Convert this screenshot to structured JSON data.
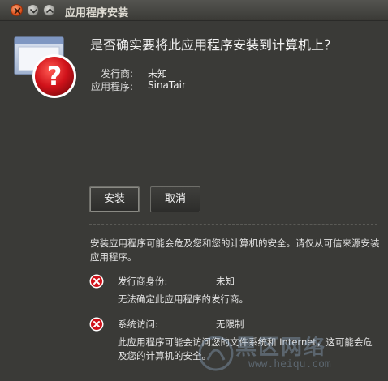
{
  "window": {
    "title": "应用程序安装"
  },
  "dialog": {
    "question": "是否确实要将此应用程序安装到计算机上？",
    "publisher_label": "发行商:",
    "publisher_value": "未知",
    "app_label": "应用程序:",
    "app_value": "SinaTair",
    "install_button": "安装",
    "cancel_button": "取消",
    "warning_text": "安装应用程序可能会危及您和您的计算机的安全。请仅从可信来源安装应用程序。",
    "items": [
      {
        "label": "发行商身份:",
        "value": "未知",
        "description": "无法确定此应用程序的发行商。"
      },
      {
        "label": "系统访问:",
        "value": "无限制",
        "description": "此应用程序可能会访问您的文件系统和 Internet，这可能会危及您的计算机的安全。"
      }
    ]
  },
  "watermark": {
    "text": "黑区网络",
    "url": "www.heiqu.com"
  },
  "colors": {
    "background": "#3a3a37",
    "titlebar": "#3b3a36",
    "close_button": "#e0541f",
    "error_red": "#d0121a",
    "text": "#e6e6e6"
  },
  "icons": {
    "app": "application-window-question-icon",
    "error": "red-x-circle-icon",
    "close": "close-icon",
    "minimize": "minimize-icon",
    "maximize": "maximize-icon"
  }
}
